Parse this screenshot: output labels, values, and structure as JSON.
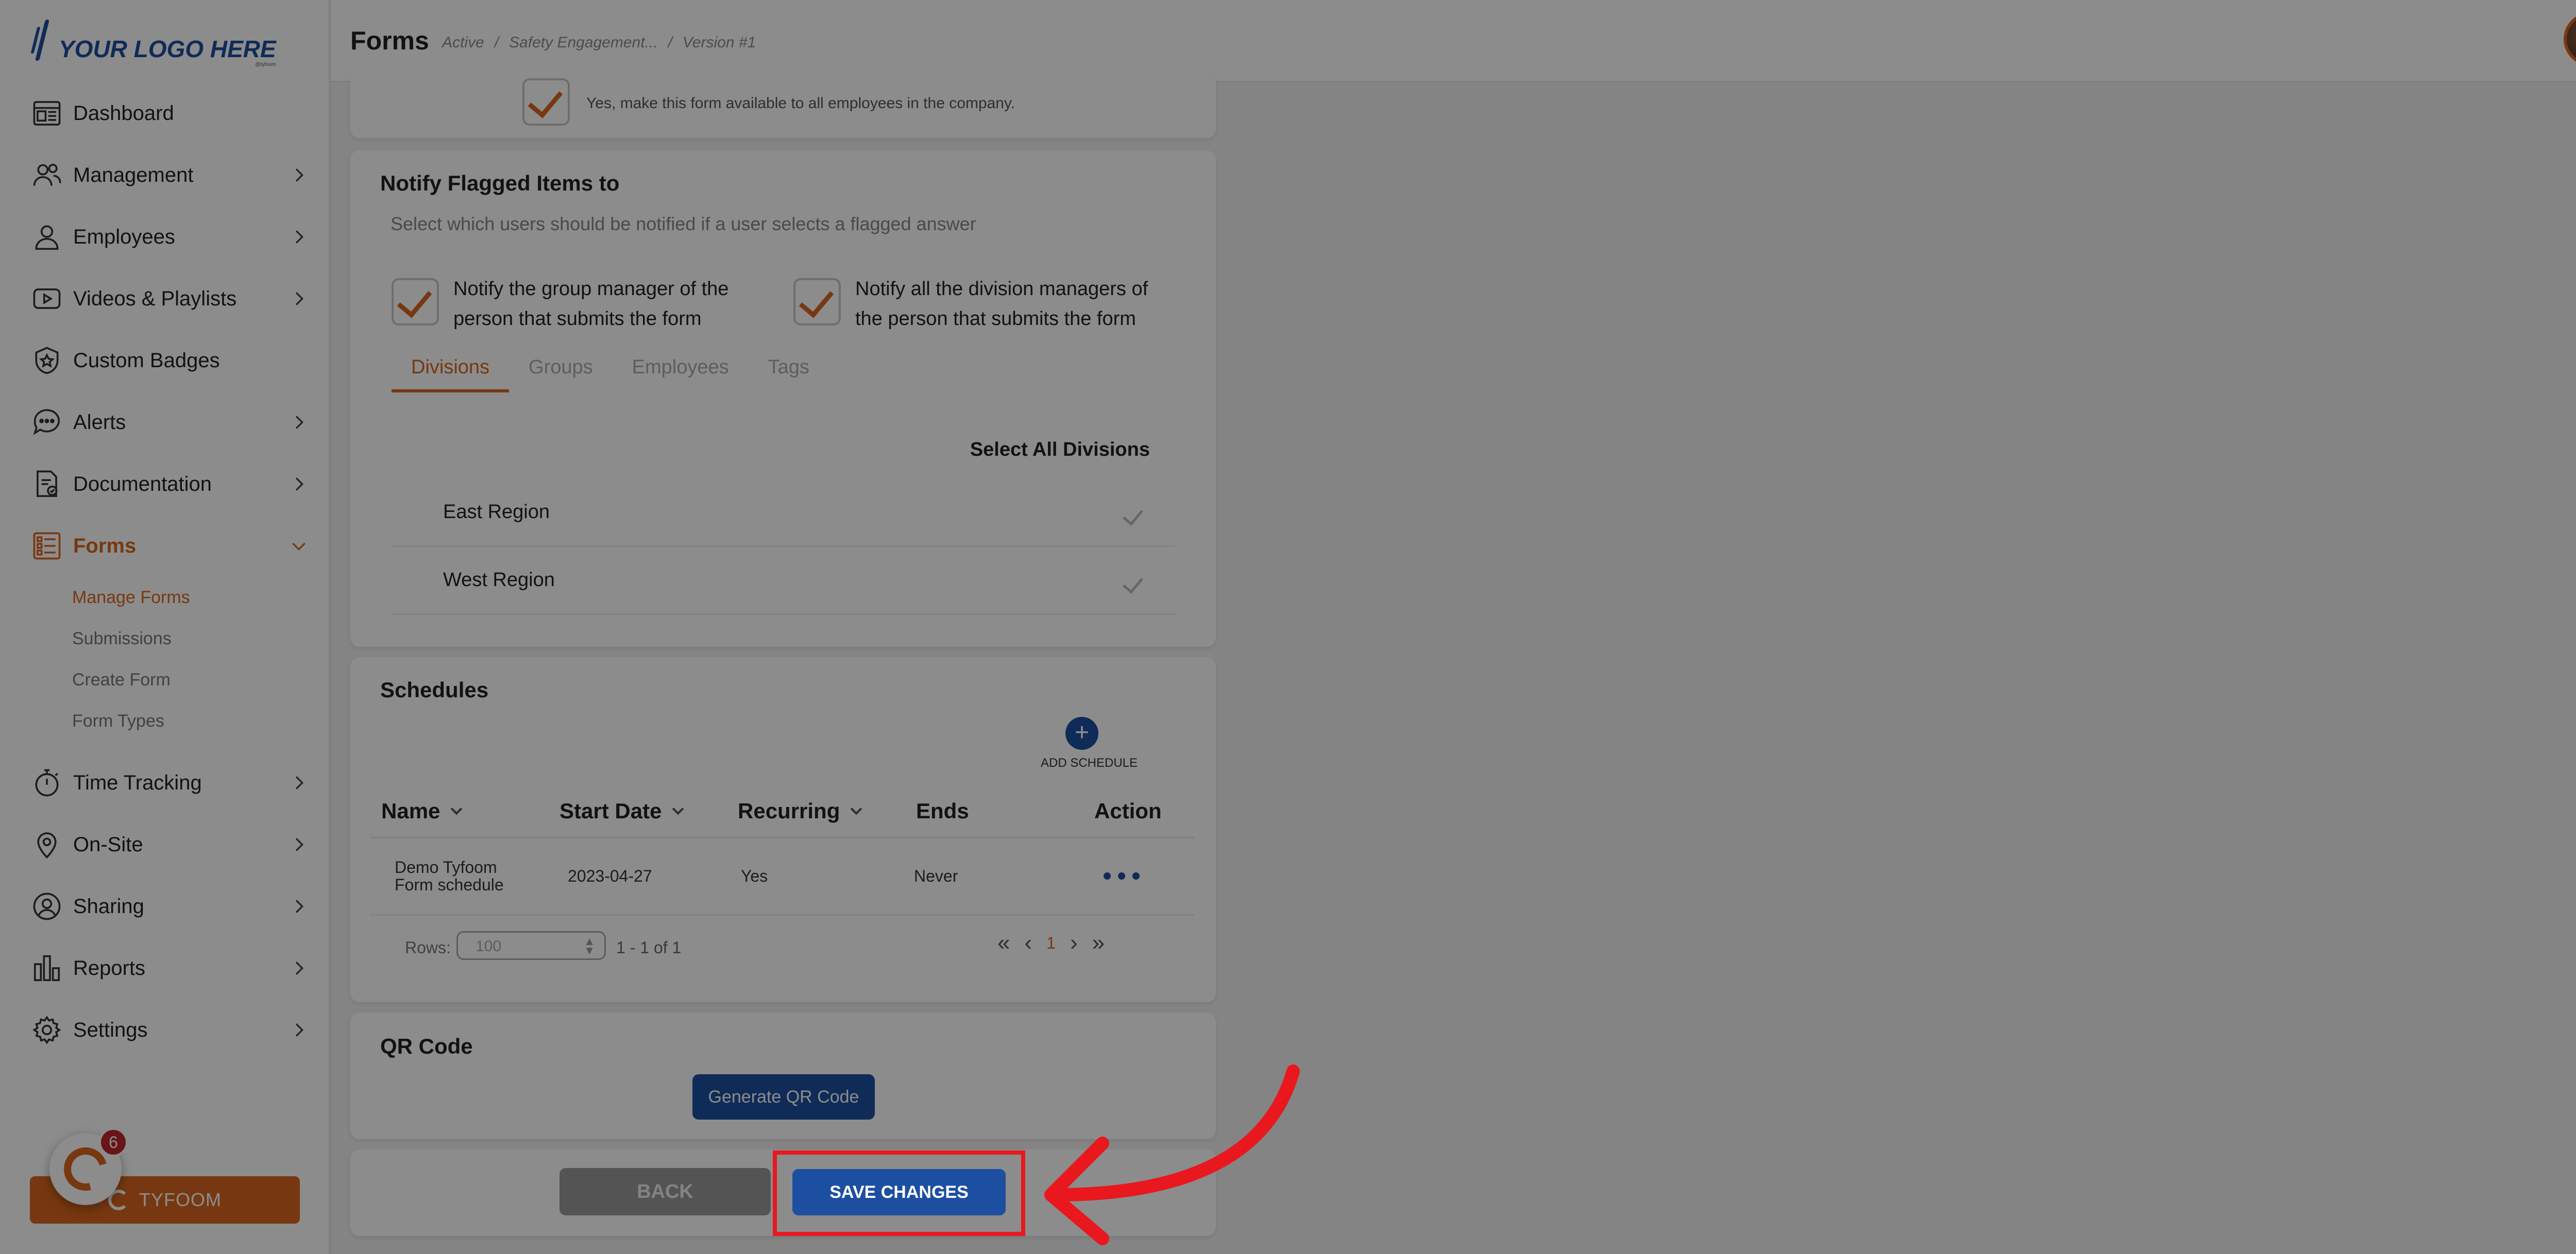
{
  "logo": {
    "text": "YOUR LOGO HERE",
    "sub": "@tyfoom"
  },
  "header": {
    "title": "Forms",
    "crumbs": [
      "Active",
      "/",
      "Safety Engagement...",
      "/",
      "Version #1"
    ]
  },
  "sidebar": {
    "items": [
      {
        "label": "Dashboard",
        "icon": "dashboard-icon"
      },
      {
        "label": "Management",
        "icon": "management-icon"
      },
      {
        "label": "Employees",
        "icon": "employees-icon"
      },
      {
        "label": "Videos & Playlists",
        "icon": "video-icon"
      },
      {
        "label": "Custom Badges",
        "icon": "badge-icon"
      },
      {
        "label": "Alerts",
        "icon": "alerts-icon"
      },
      {
        "label": "Documentation",
        "icon": "documentation-icon"
      },
      {
        "label": "Forms",
        "icon": "forms-icon"
      },
      {
        "label": "Time Tracking",
        "icon": "stopwatch-icon"
      },
      {
        "label": "On-Site",
        "icon": "location-pin-icon"
      },
      {
        "label": "Sharing",
        "icon": "sharing-icon"
      },
      {
        "label": "Reports",
        "icon": "reports-icon"
      },
      {
        "label": "Settings",
        "icon": "gear-icon"
      }
    ],
    "forms_sub": [
      "Manage Forms",
      "Submissions",
      "Create Form",
      "Form Types"
    ],
    "tyfoom_label": "TYFOOM",
    "chat_badge": "6"
  },
  "availability": {
    "text": "Yes, make this form available to all employees in the company."
  },
  "notify": {
    "title": "Notify Flagged Items to",
    "subtitle": "Select which users should be notified if a user selects a flagged answer",
    "option1_line1": "Notify the group manager of the",
    "option1_line2": "person that submits the form",
    "option2_line1": "Notify all the division managers of",
    "option2_line2": "the person that submits the form",
    "tabs": [
      "Divisions",
      "Groups",
      "Employees",
      "Tags"
    ],
    "select_all": "Select All Divisions",
    "divisions": [
      "East Region",
      "West Region"
    ]
  },
  "schedules": {
    "title": "Schedules",
    "add_label": "ADD SCHEDULE",
    "columns": [
      "Name",
      "Start Date",
      "Recurring",
      "Ends",
      "Action"
    ],
    "rows": [
      {
        "name_line1": "Demo Tyfoom",
        "name_line2": "Form schedule",
        "start": "2023-04-27",
        "recurring": "Yes",
        "ends": "Never"
      }
    ],
    "rows_label": "Rows:",
    "rows_value": "100",
    "range": "1 - 1 of 1",
    "page": "1"
  },
  "qr": {
    "title": "QR Code",
    "button": "Generate QR Code"
  },
  "footer": {
    "back": "BACK",
    "save": "SAVE CHANGES"
  },
  "colors": {
    "accent": "#d9661f",
    "primary": "#1d4fa0",
    "highlight": "#e8181e"
  }
}
